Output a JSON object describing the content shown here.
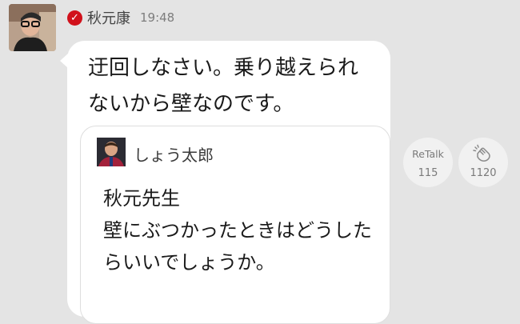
{
  "post": {
    "author": "秋元康",
    "time": "19:48",
    "message": "迂回しなさい。乗り越えられないから壁なのです。",
    "verified_icon": "verified-check-icon"
  },
  "quote": {
    "author": "しょう太郎",
    "message": "秋元先生\n壁にぶつかったときはどうしたらいいでしょうか。"
  },
  "actions": {
    "retalk_label": "ReTalk",
    "retalk_count": "115",
    "clap_count": "1120",
    "clap_icon": "clap-icon"
  },
  "colors": {
    "background": "#e4e4e4",
    "bubble": "#ffffff",
    "verified": "#d1111b",
    "muted": "#7a7a7a"
  }
}
